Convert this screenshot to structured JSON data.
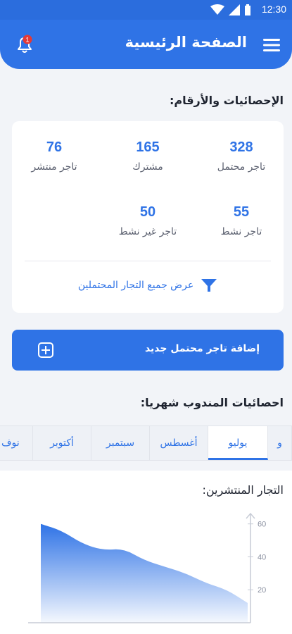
{
  "status": {
    "time": "12:30"
  },
  "header": {
    "title": "الصفحة الرئيسية",
    "notification_count": "1"
  },
  "stats": {
    "section_title": "الإحصائيات والأرقام:",
    "items": [
      {
        "value": "328",
        "label": "تاجر محتمل"
      },
      {
        "value": "165",
        "label": "مشترك"
      },
      {
        "value": "76",
        "label": "تاجر منتشر"
      },
      {
        "value": "55",
        "label": "تاجر نشط"
      },
      {
        "value": "50",
        "label": "تاجر غير نشط"
      }
    ],
    "filter_label": "عرض جميع التجار المحتملين"
  },
  "add_button": {
    "label": "إضافة تاجر محتمل جديد"
  },
  "monthly": {
    "section_title": "احصائيات المندوب شهريا:",
    "tabs": [
      "و",
      "يوليو",
      "أغسطس",
      "سبتمبر",
      "أكتوبر",
      "نوف"
    ],
    "active_tab": "يوليو"
  },
  "chart_data": {
    "type": "area",
    "title": "التجار المنتشرين:",
    "y_ticks": [
      "20",
      "40",
      "60"
    ],
    "ylim": [
      0,
      65
    ],
    "x": [
      0,
      1,
      2,
      3,
      4,
      5,
      6,
      7,
      8,
      9,
      10
    ],
    "values": [
      60,
      56,
      48,
      44,
      45,
      38,
      34,
      30,
      24,
      20,
      12
    ],
    "colors": {
      "fill_top": "#2f73e6",
      "fill_bottom": "#ffffff"
    }
  },
  "colors": {
    "primary": "#2f73e6",
    "background": "#f2f4f8"
  }
}
